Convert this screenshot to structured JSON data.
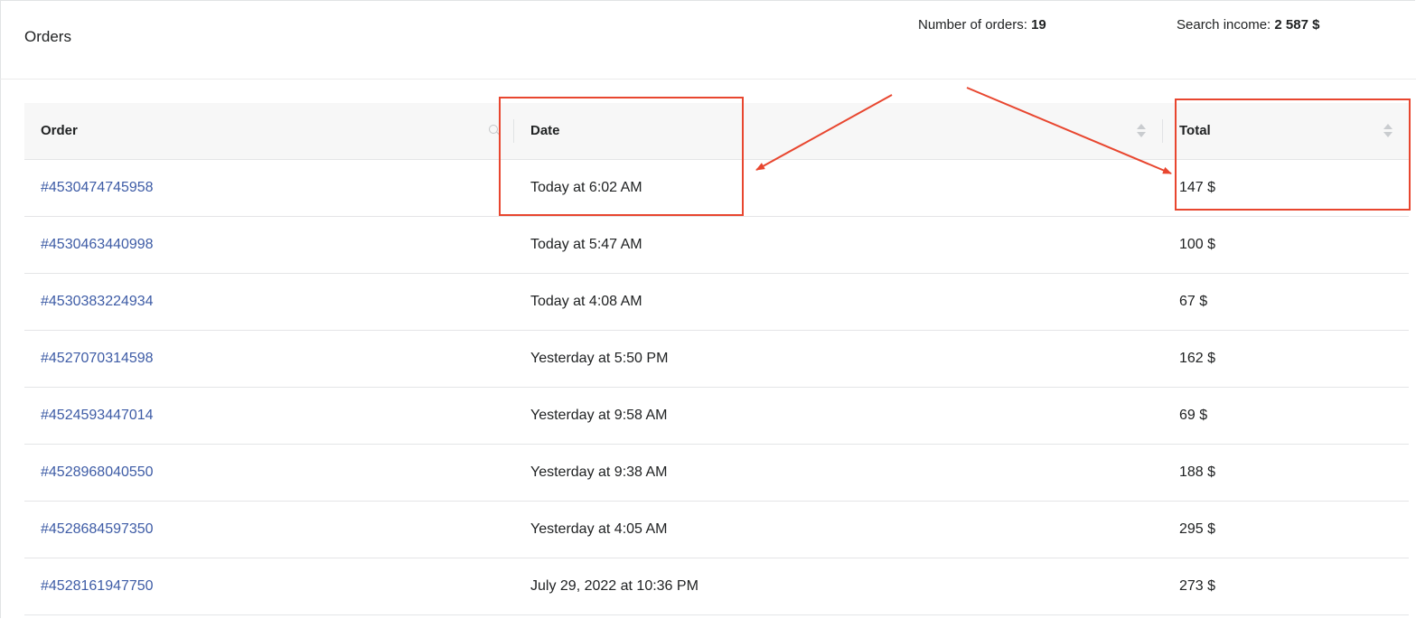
{
  "header": {
    "title": "Orders",
    "orders_label": "Number of orders:",
    "orders_value": "19",
    "income_label": "Search income:",
    "income_value": "2 587 $"
  },
  "table": {
    "columns": {
      "order": "Order",
      "date": "Date",
      "total": "Total"
    },
    "rows": [
      {
        "order": "#4530474745958",
        "date": "Today at 6:02 AM",
        "total": "147 $"
      },
      {
        "order": "#4530463440998",
        "date": "Today at 5:47 AM",
        "total": "100 $"
      },
      {
        "order": "#4530383224934",
        "date": "Today at 4:08 AM",
        "total": "67 $"
      },
      {
        "order": "#4527070314598",
        "date": "Yesterday at 5:50 PM",
        "total": "162 $"
      },
      {
        "order": "#4524593447014",
        "date": "Yesterday at 9:58 AM",
        "total": "69 $"
      },
      {
        "order": "#4528968040550",
        "date": "Yesterday at 9:38 AM",
        "total": "188 $"
      },
      {
        "order": "#4528684597350",
        "date": "Yesterday at 4:05 AM",
        "total": "295 $"
      },
      {
        "order": "#4528161947750",
        "date": "July 29, 2022 at 10:36 PM",
        "total": "273 $"
      }
    ]
  },
  "icons": {
    "order_search": "search-icon",
    "date_sort": "sort-icon",
    "total_sort": "sort-icon"
  },
  "colors": {
    "link": "#3e5ca6",
    "annotation": "#e8462f",
    "header_bg": "#f7f7f7"
  }
}
